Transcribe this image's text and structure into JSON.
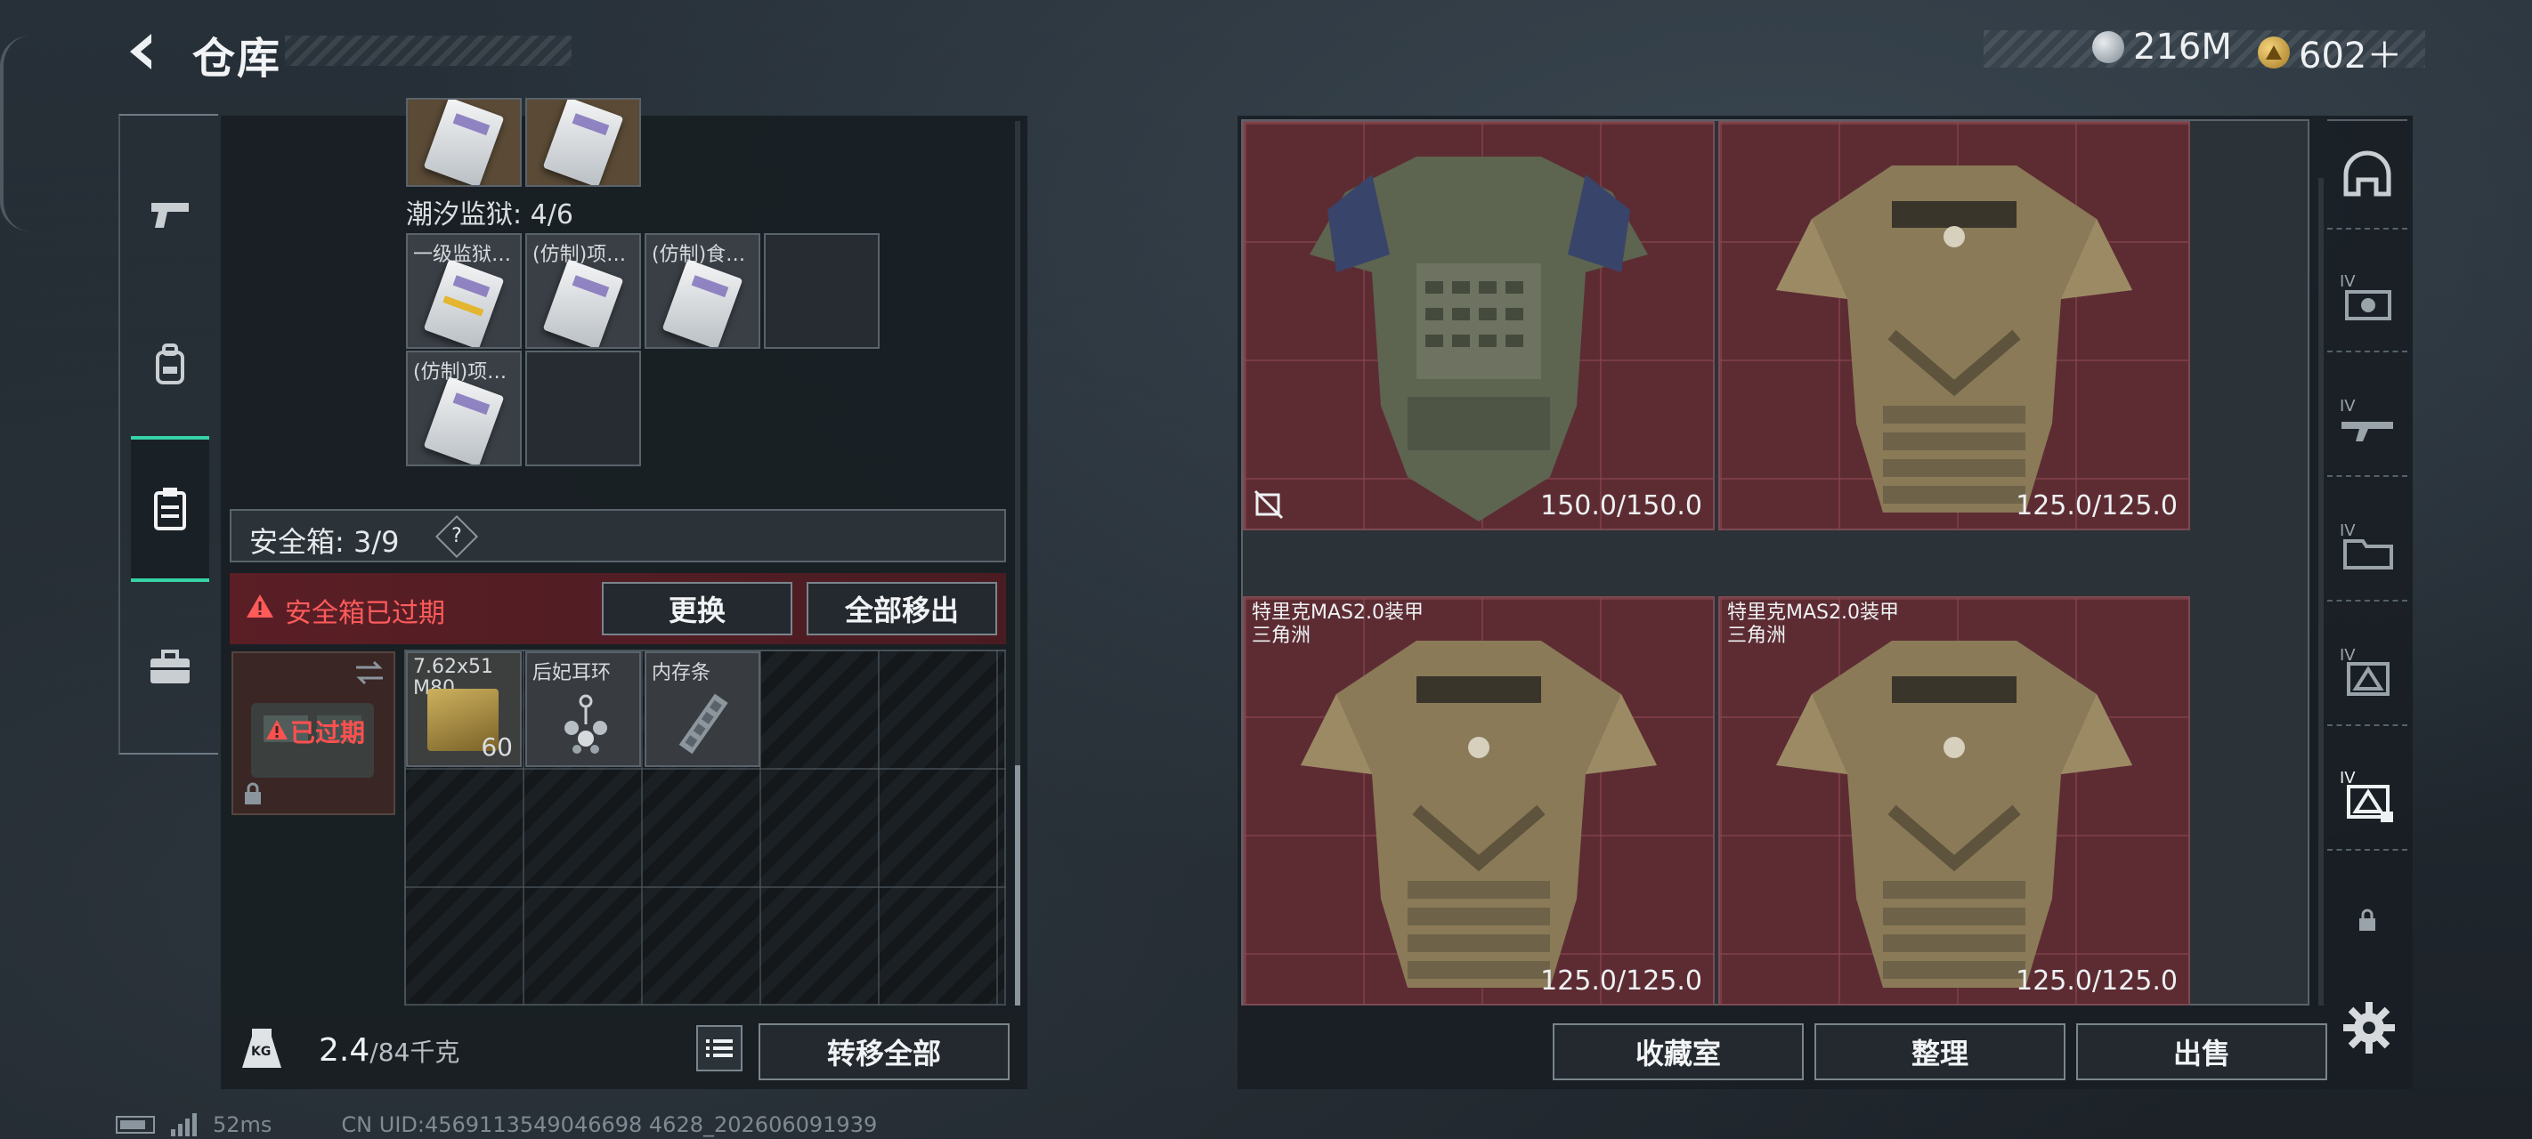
{
  "header": {
    "title": "仓库",
    "currency": [
      {
        "icon": "silver-coin-icon",
        "value": "216M"
      },
      {
        "icon": "gold-coin-icon",
        "value": "602＋"
      }
    ]
  },
  "left_nav": {
    "items": [
      {
        "icon": "pistol-icon"
      },
      {
        "icon": "backpack-icon"
      },
      {
        "icon": "clipboard-icon",
        "active": true
      },
      {
        "icon": "briefcase-icon"
      }
    ]
  },
  "stash": {
    "top_partial_items": [
      {
        "icon": "keycard-icon"
      },
      {
        "icon": "keycard-icon"
      }
    ],
    "section_label": "潮汐监狱: 4/6",
    "keycards": [
      {
        "label": "一级监狱…",
        "icon": "keycard-icon"
      },
      {
        "label": "(仿制)项…",
        "icon": "keycard-icon"
      },
      {
        "label": "(仿制)食…",
        "icon": "keycard-icon"
      },
      {
        "label": "(仿制)项…",
        "icon": "keycard-icon"
      }
    ]
  },
  "safe_box": {
    "title": "安全箱: 3/9",
    "help": "?",
    "expired_msg": "安全箱已过期",
    "replace_label": "更换",
    "move_all_out_label": "全部移出",
    "box_status": "已过期",
    "items": [
      {
        "label": "7.62x51 M80",
        "count": "60",
        "icon": "ammo-box-icon"
      },
      {
        "label": "后妃耳环",
        "icon": "earring-icon"
      },
      {
        "label": "内存条",
        "icon": "memory-stick-icon"
      }
    ]
  },
  "footer_left": {
    "weight_icon_text": "KG",
    "weight_value": "2.4",
    "weight_max": "/84千克",
    "transfer_all_label": "转移全部"
  },
  "armor": [
    {
      "name": "",
      "subtitle": "",
      "durability": "150.0/150.0",
      "icon": "green-body-armor-icon",
      "no_insure": true
    },
    {
      "name": "",
      "subtitle": "",
      "durability": "125.0/125.0",
      "icon": "camo-body-armor-icon"
    },
    {
      "name": "特里克MAS2.0装甲",
      "subtitle": "三角洲",
      "durability": "125.0/125.0",
      "icon": "camo-body-armor-icon"
    },
    {
      "name": "特里克MAS2.0装甲",
      "subtitle": "三角洲",
      "durability": "125.0/125.0",
      "icon": "camo-body-armor-icon"
    }
  ],
  "right_rail": {
    "items": [
      {
        "icon": "helmet-icon",
        "tier": ""
      },
      {
        "icon": "tier-IV-gear-icon",
        "tier": "IV"
      },
      {
        "icon": "tier-IV-rifle-icon",
        "tier": "IV"
      },
      {
        "icon": "tier-IV-folder-icon",
        "tier": "IV"
      },
      {
        "icon": "tier-IV-armor-icon",
        "tier": "IV"
      },
      {
        "icon": "tier-IV-armor-locked-icon",
        "tier": "IV",
        "active": true
      },
      {
        "icon": "lock-icon",
        "tier": ""
      }
    ]
  },
  "actions": {
    "collection_label": "收藏室",
    "organize_label": "整理",
    "sell_label": "出售"
  },
  "status": {
    "ping": "52ms",
    "uid": "CN UID:4569113549046698 4628_202606091939"
  },
  "colors": {
    "accent": "#36d3a6",
    "danger": "#ff5b5b",
    "armor_cell": "#5d2c33"
  }
}
